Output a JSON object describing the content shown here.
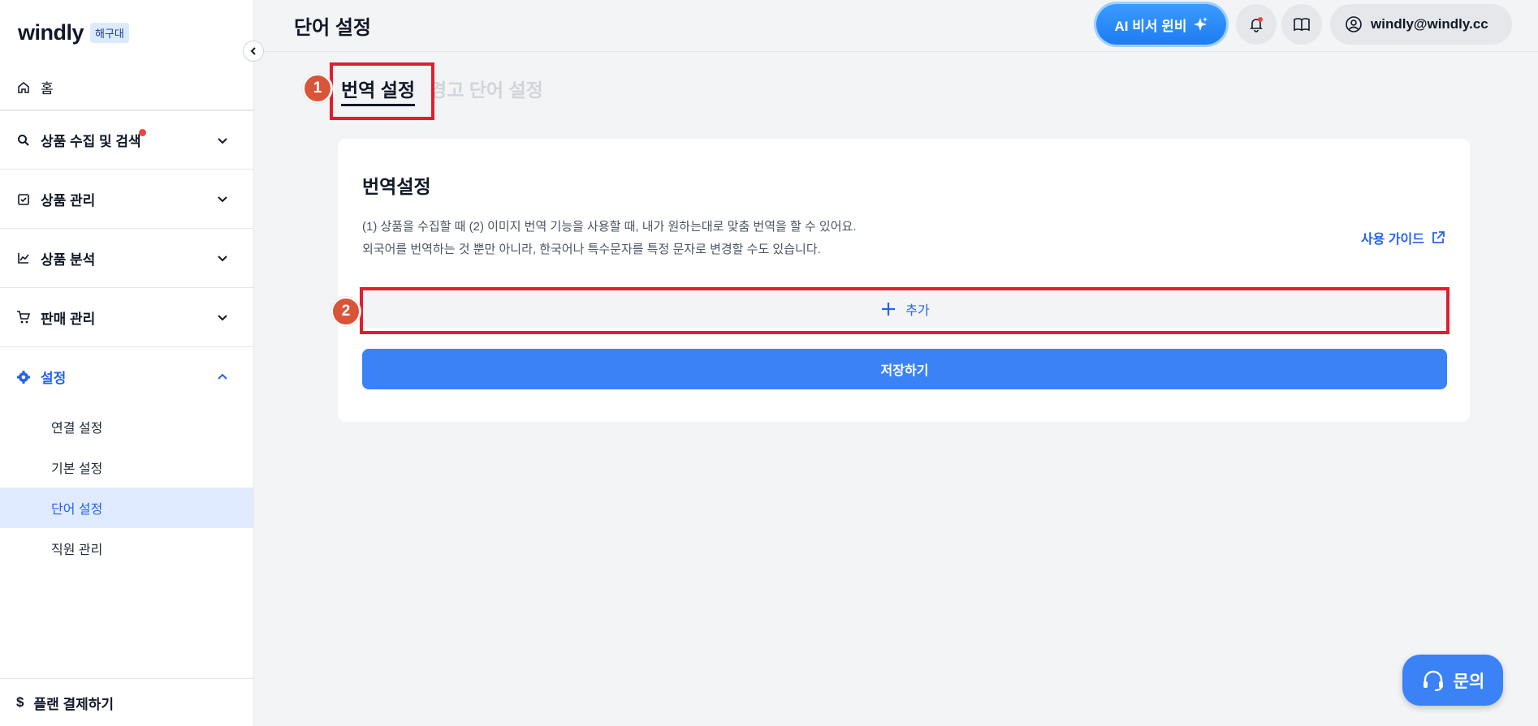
{
  "sidebar": {
    "logo": "windly",
    "badge": "해구대",
    "home": "홈",
    "items": [
      {
        "label": "상품 수집 및 검색"
      },
      {
        "label": "상품 관리"
      },
      {
        "label": "상품 분석"
      },
      {
        "label": "판매 관리"
      },
      {
        "label": "설정"
      }
    ],
    "sub_items": [
      "연결 설정",
      "기본 설정",
      "단어 설정",
      "직원 관리"
    ],
    "plan": "플랜 결제하기"
  },
  "header": {
    "title": "단어 설정",
    "ai_button": "AI 비서 윈비",
    "user_email": "windly@windly.cc"
  },
  "tabs": {
    "active": "번역 설정",
    "inactive": "경고 단어 설정"
  },
  "steps": [
    "1",
    "2"
  ],
  "card": {
    "title": "번역설정",
    "desc_line1": "(1) 상품을 수집할 때 (2) 이미지 번역 기능을 사용할 때, 내가 원하는대로 맞춤 번역을 할 수 있어요.",
    "desc_line2": "외국어를 번역하는 것 뿐만 아니라, 한국어나 특수문자를 특정 문자로 변경할 수도 있습니다.",
    "guide": "사용 가이드",
    "add_label": "추가",
    "save_label": "저장하기"
  },
  "inquiry": "문의",
  "colors": {
    "accent": "#3b82f6",
    "highlight": "#e11d2e",
    "step": "#d9553a"
  }
}
